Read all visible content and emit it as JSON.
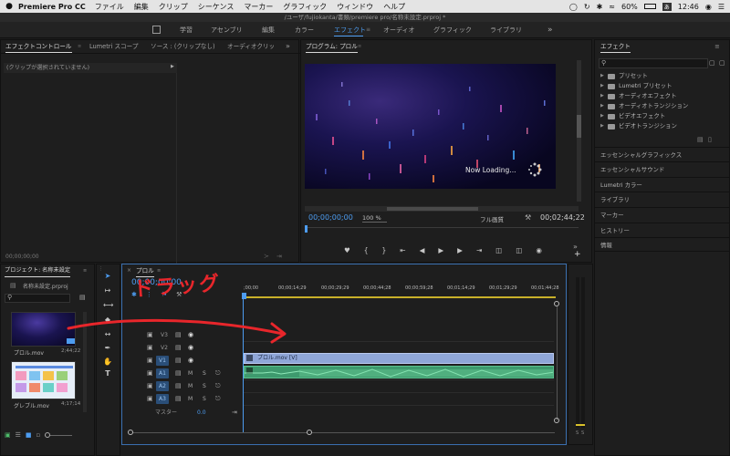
{
  "menubar": {
    "app_name": "Premiere Pro CC",
    "items": [
      "ファイル",
      "編集",
      "クリップ",
      "シーケンス",
      "マーカー",
      "グラフィック",
      "ウィンドウ",
      "ヘルプ"
    ],
    "battery": "60%",
    "clock": "12:46"
  },
  "window_title": "/ユーザ/fujiokanta/書類/premiere pro/名称未設定.prproj *",
  "workspaces": [
    "学習",
    "アセンブリ",
    "編集",
    "カラー",
    "エフェクト",
    "オーディオ",
    "グラフィック",
    "ライブラリ"
  ],
  "workspaces_active": "エフェクト",
  "effect_controls": {
    "tabs": [
      "エフェクトコントロール",
      "Lumetri スコープ",
      "ソース : (クリップなし)",
      "オーディオクリッ"
    ],
    "no_clip_message": "(クリップが選択されていません)",
    "timecode": "00;00;00;00"
  },
  "program_monitor": {
    "tab": "プログラム: プロル",
    "loading_text": "Now Loading...",
    "current_timecode": "00;00;00;00",
    "zoom": "100 %",
    "quality": "フル画質",
    "duration": "00;02;44;22"
  },
  "effects_panel": {
    "title": "エフェクト",
    "items": [
      "プリセット",
      "Lumetri プリセット",
      "オーディオエフェクト",
      "オーディオトランジション",
      "ビデオエフェクト",
      "ビデオトランジション"
    ],
    "sections": [
      "エッセンシャルグラフィックス",
      "エッセンシャルサウンド",
      "Lumetri カラー",
      "ライブラリ",
      "マーカー",
      "ヒストリー",
      "情報"
    ]
  },
  "project_panel": {
    "title": "プロジェクト: 名称未設定",
    "file": "名称未設定.prproj",
    "clips": [
      {
        "name": "プロル.mov",
        "duration": "2;44;22"
      },
      {
        "name": "グレブル.mov",
        "duration": "4;17;14"
      }
    ]
  },
  "timeline": {
    "sequence_name": "プロル",
    "timecode": "00;00;00;00",
    "ruler": [
      ";00;00",
      "00;00;14;29",
      "00;00;29;29",
      "00;00;44;28",
      "00;00;59;28",
      "00;01;14;29",
      "00;01;29;29",
      "00;01;44;28",
      "00;01;59;"
    ],
    "video_tracks": [
      "V3",
      "V2",
      "V1"
    ],
    "audio_tracks": [
      "A1",
      "A2",
      "A3"
    ],
    "master_label": "マスター",
    "master_value": "0.0",
    "video_clip": "プロル.mov [V]",
    "annotation": "ドラッグ"
  },
  "audio_meter": {
    "labels": [
      "S",
      "S"
    ]
  },
  "colors": {
    "accent": "#4d9cf0",
    "video_clip": "#8fa6d8",
    "audio_clip": "#3e9a6e",
    "annotation": "#e8262b"
  }
}
